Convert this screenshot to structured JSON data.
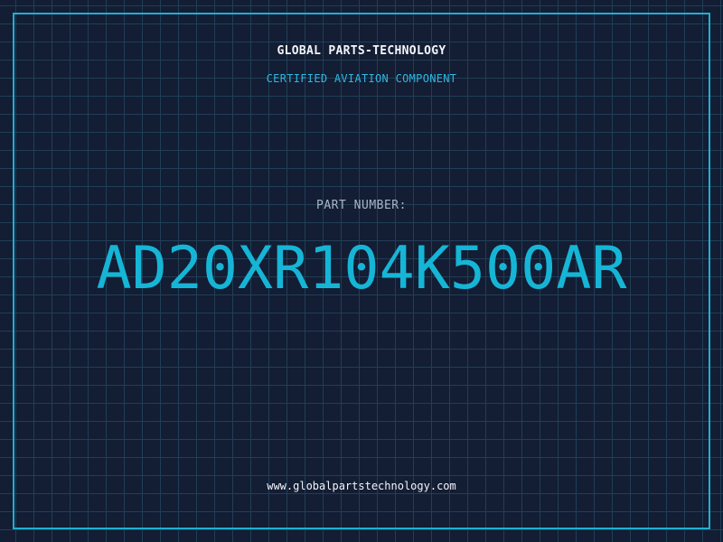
{
  "header": {
    "company": "GLOBAL PARTS-TECHNOLOGY",
    "tagline": "CERTIFIED AVIATION COMPONENT"
  },
  "part": {
    "label": "PART NUMBER:",
    "number": "AD20XR104K500AR"
  },
  "footer": {
    "website": "www.globalpartstechnology.com"
  },
  "colors": {
    "background": "#131d33",
    "grid": "#1f3f56",
    "accent": "#1eb0d2",
    "text": "#f2f5fa",
    "muted": "#a9b5c9"
  }
}
